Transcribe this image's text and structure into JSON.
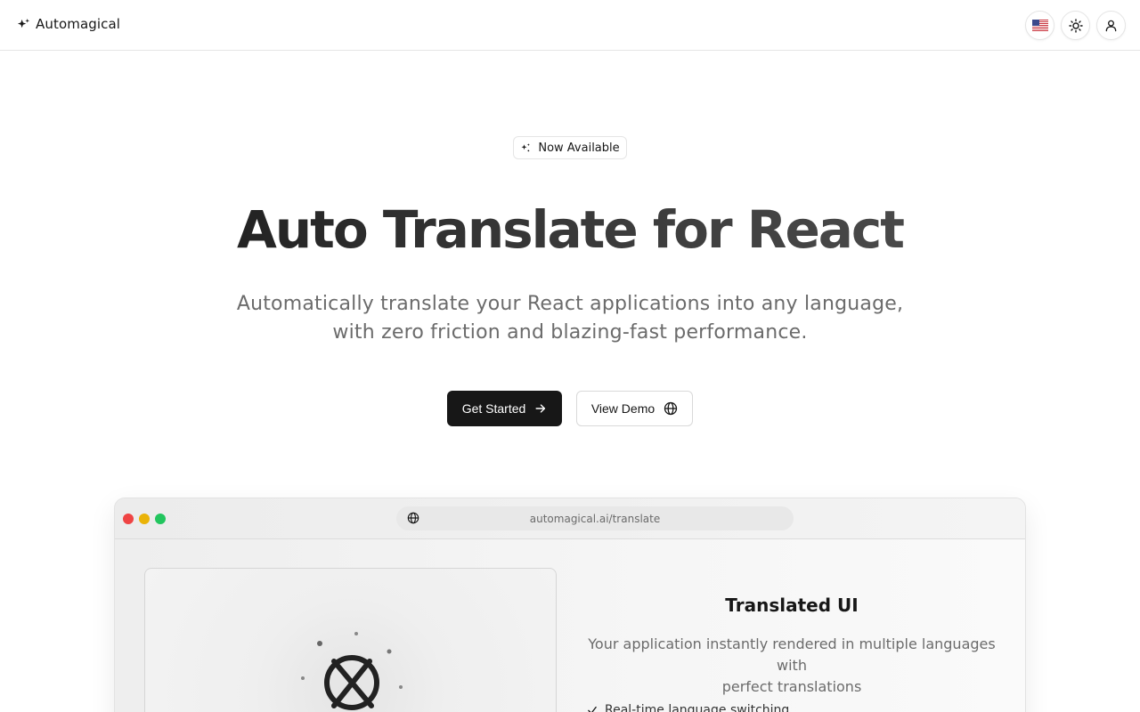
{
  "header": {
    "brand_name": "Automagical",
    "language_flag": "us-flag-icon",
    "theme_toggle_icon": "sun-icon",
    "user_icon": "user-icon"
  },
  "hero": {
    "badge_text": "Now Available",
    "title": "Auto Translate for React",
    "subtitle_line1": "Automatically translate your React applications into any language,",
    "subtitle_line2": "with zero friction and blazing-fast performance.",
    "primary_button": "Get Started",
    "secondary_button": "View Demo"
  },
  "demo": {
    "url": "automagical.ai/translate",
    "right_title": "Translated UI",
    "right_desc_line1": "Your application instantly rendered in multiple languages with",
    "right_desc_line2": "perfect translations",
    "feature_1": "Real-time language switching"
  },
  "colors": {
    "primary": "#171717",
    "muted_text": "#6b6b6b",
    "border": "#e5e5e5",
    "traffic_red": "#ef4444",
    "traffic_yellow": "#eab308",
    "traffic_green": "#22c55e"
  }
}
